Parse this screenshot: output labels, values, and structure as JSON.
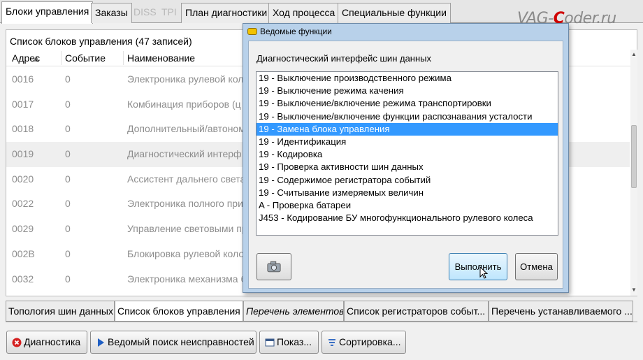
{
  "top_tabs": [
    {
      "label": "Блоки управления",
      "state": "active"
    },
    {
      "label": "Заказы",
      "state": "normal"
    },
    {
      "label": "DISS",
      "state": "disabled"
    },
    {
      "label": "TPI",
      "state": "disabled"
    },
    {
      "label": "План диагностики",
      "state": "normal"
    },
    {
      "label": "Ход процесса",
      "state": "normal"
    },
    {
      "label": "Специальные функции",
      "state": "normal"
    }
  ],
  "watermark": {
    "pre": "VAG-",
    "c": "C",
    "post": "oder.ru"
  },
  "list": {
    "title": "Список блоков управления (47 записей)",
    "columns": [
      "Адрес",
      "Событие",
      "Наименование"
    ],
    "rows": [
      {
        "address": "0016",
        "event": "0",
        "name": "Электроника рулевой колонки"
      },
      {
        "address": "0017",
        "event": "0",
        "name": "Комбинация приборов (ц"
      },
      {
        "address": "0018",
        "event": "0",
        "name": "Дополнительный/автоном"
      },
      {
        "address": "0019",
        "event": "0",
        "name": "Диагностический интерф"
      },
      {
        "address": "0020",
        "event": "0",
        "name": "Ассистент дальнего света"
      },
      {
        "address": "0022",
        "event": "0",
        "name": "Электроника полного при"
      },
      {
        "address": "0029",
        "event": "0",
        "name": "Управление световыми пр"
      },
      {
        "address": "002B",
        "event": "0",
        "name": "Блокировка рулевой колонки"
      },
      {
        "address": "0032",
        "event": "0",
        "name": "Электроника механизма б"
      }
    ],
    "selected_row": 3
  },
  "bottom_tabs": [
    {
      "label": "Топология шин данных",
      "style": "normal"
    },
    {
      "label": "Список блоков управления",
      "style": "active"
    },
    {
      "label": "Перечень элементов",
      "style": "italic"
    },
    {
      "label": "Список регистраторов событ...",
      "style": "normal"
    },
    {
      "label": "Перечень устанавливаемого ...",
      "style": "normal"
    }
  ],
  "bottom_buttons": {
    "diagnostics": "Диагностика",
    "guided_search": "Ведомый поиск неисправностей",
    "show": "Показ...",
    "sort": "Сортировка..."
  },
  "dialog": {
    "title": "Ведомые функции",
    "heading": "Диагностический интерфейс шин данных",
    "items": [
      "19 - Выключение производственного режима",
      "19 - Выключение режима качения",
      "19 - Выключение/включение режима транспортировки",
      "19 - Выключение/включение функции распознавания усталости",
      "19 - Замена блока управления",
      "19 - Идентификация",
      "19 - Кодировка",
      "19 - Проверка активности шин данных",
      "19 - Содержимое регистратора событий",
      "19 - Считывание измеряемых величин",
      "A - Проверка батареи",
      "J453 - Кодирование БУ многофункционального рулевого колеса"
    ],
    "selected_index": 4,
    "execute_label": "Выполнить",
    "cancel_label": "Отмена"
  },
  "colors": {
    "selection": "#3399ff",
    "dialog_frame": "#b8d1ea",
    "watermark_c": "#d00000"
  }
}
